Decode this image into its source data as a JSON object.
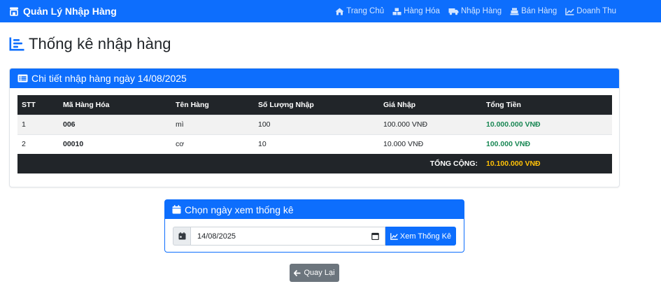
{
  "navbar": {
    "brand": "Quản Lý Nhập Hàng",
    "items": [
      {
        "label": "Trang Chủ",
        "icon": "home-icon"
      },
      {
        "label": "Hàng Hóa",
        "icon": "boxes-icon"
      },
      {
        "label": "Nhập Hàng",
        "icon": "truck-icon"
      },
      {
        "label": "Bán Hàng",
        "icon": "cash-register-icon"
      },
      {
        "label": "Doanh Thu",
        "icon": "chart-line-icon"
      }
    ]
  },
  "page": {
    "title": "Thống kê nhập hàng",
    "title_icon": "list-chart-icon"
  },
  "detail_card": {
    "title": "Chi tiết nhập hàng ngày 14/08/2025",
    "icon": "list-alt-icon",
    "columns": [
      "STT",
      "Mã Hàng Hóa",
      "Tên Hàng",
      "Số Lượng Nhập",
      "Giá Nhập",
      "Tổng Tiền"
    ],
    "rows": [
      {
        "stt": "1",
        "code": "006",
        "name": "mì",
        "qty": "100",
        "price": "100.000 VNĐ",
        "total": "10.000.000 VNĐ"
      },
      {
        "stt": "2",
        "code": "00010",
        "name": "cơ",
        "qty": "10",
        "price": "10.000 VNĐ",
        "total": "100.000 VNĐ"
      }
    ],
    "footer_label": "TỔNG CỘNG:",
    "footer_total": "10.100.000 VNĐ"
  },
  "date_card": {
    "title": "Chọn ngày xem thống kê",
    "icon": "calendar-icon",
    "date_value": "14/08/2025",
    "button_label": "Xem Thống Kê"
  },
  "back_button": {
    "label": "Quay Lại"
  },
  "colors": {
    "primary": "#0d6efd",
    "dark": "#212529",
    "success": "#198754",
    "warning": "#ffc107",
    "secondary": "#6c757d"
  }
}
